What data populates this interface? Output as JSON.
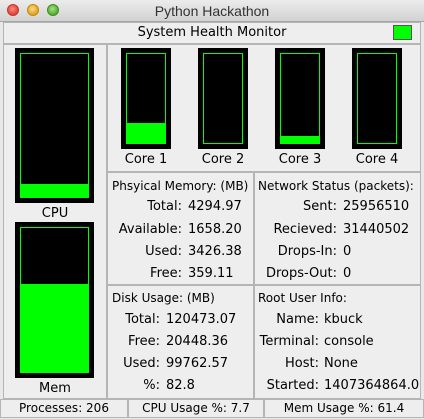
{
  "window": {
    "title": "Python Hackathon"
  },
  "header": {
    "title": "System Health Monitor",
    "status_color": "#00ff00"
  },
  "colors": {
    "meter_fill": "#00ff00",
    "meter_bg": "#000000"
  },
  "main_meters": [
    {
      "label": "CPU",
      "level": 0.09
    },
    {
      "label": "Mem",
      "level": 0.61
    }
  ],
  "cores": [
    {
      "label": "Core 1",
      "level": 0.22
    },
    {
      "label": "Core 2",
      "level": 0.0
    },
    {
      "label": "Core 3",
      "level": 0.08
    },
    {
      "label": "Core 4",
      "level": 0.0
    }
  ],
  "physical_memory": {
    "title": "Phsyical Memory: (MB)",
    "rows": [
      {
        "label": "Total:",
        "value": "4294.97"
      },
      {
        "label": "Available:",
        "value": "1658.20"
      },
      {
        "label": "Used:",
        "value": "3426.38"
      },
      {
        "label": "Free:",
        "value": "359.11"
      }
    ]
  },
  "network": {
    "title": "Network Status (packets):",
    "rows": [
      {
        "label": "Sent:",
        "value": "25956510"
      },
      {
        "label": "Recieved:",
        "value": "31440502"
      },
      {
        "label": "Drops-In:",
        "value": "0"
      },
      {
        "label": "Drops-Out:",
        "value": "0"
      }
    ]
  },
  "disk": {
    "title": "Disk Usage: (MB)",
    "rows": [
      {
        "label": "Total:",
        "value": "120473.07"
      },
      {
        "label": "Free:",
        "value": "20448.36"
      },
      {
        "label": "Used:",
        "value": "99762.57"
      },
      {
        "label": "%:",
        "value": "82.8"
      }
    ]
  },
  "root_user": {
    "title": "Root User Info:",
    "rows": [
      {
        "label": "Name:",
        "value": "kbuck"
      },
      {
        "label": "Terminal:",
        "value": "console"
      },
      {
        "label": "Host:",
        "value": "None"
      },
      {
        "label": "Started:",
        "value": "1407364864.0"
      }
    ]
  },
  "status_bar": {
    "processes": "Processes: 206",
    "cpu_usage": "CPU Usage %: 7.7",
    "mem_usage": "Mem Usage %: 61.4"
  }
}
